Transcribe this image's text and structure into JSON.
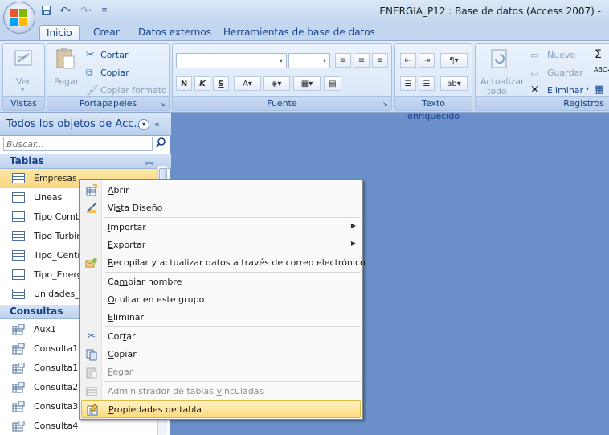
{
  "window": {
    "title": "ENERGIA_P12 : Base de datos (Access 2007) -"
  },
  "tabs": [
    "Inicio",
    "Crear",
    "Datos externos",
    "Herramientas de base de datos"
  ],
  "ribbon": {
    "vistas": {
      "label": "Vistas",
      "ver": "Ver"
    },
    "portapapeles": {
      "label": "Portapapeles",
      "pegar": "Pegar",
      "cortar": "Cortar",
      "copiar": "Copiar",
      "copiar_formato": "Copiar formato"
    },
    "fuente": {
      "label": "Fuente"
    },
    "texto": {
      "label": "Texto enriquecido"
    },
    "registros": {
      "label": "Registros",
      "actualizar1": "Actualizar",
      "actualizar2": "todo",
      "nuevo": "Nuevo",
      "guardar": "Guardar",
      "eliminar": "Eliminar"
    }
  },
  "nav": {
    "title": "Todos los objetos de Acc...",
    "search_placeholder": "Buscar...",
    "tables_header": "Tablas",
    "tables": [
      "Empresas",
      "Lineas",
      "Tipo Comb",
      "Tipo Turbin",
      "Tipo_Centr",
      "Tipo_Energ",
      "Unidades_("
    ],
    "queries_header": "Consultas",
    "queries": [
      "Aux1",
      "Consulta1",
      "Consulta10",
      "Consulta2",
      "Consulta3",
      "Consulta4"
    ]
  },
  "context_menu": [
    {
      "label": "Abrir",
      "u": "A",
      "icon": "open-icon",
      "enabled": true
    },
    {
      "label": "Vista Diseño",
      "u": "s",
      "icon": "design-view-icon",
      "enabled": true
    },
    {
      "label": "Importar",
      "u": "I",
      "submenu": true,
      "enabled": true
    },
    {
      "label": "Exportar",
      "u": "E",
      "submenu": true,
      "enabled": true
    },
    {
      "label": "Recopilar y actualizar datos a través de correo electrónico",
      "u": "R",
      "icon": "email-collect-icon",
      "enabled": true
    },
    {
      "label": "Cambiar nombre",
      "u": "m",
      "enabled": true
    },
    {
      "label": "Ocultar en este grupo",
      "u": "O",
      "enabled": true
    },
    {
      "label": "Eliminar",
      "u": "E",
      "enabled": true
    },
    {
      "label": "Cortar",
      "u": "t",
      "icon": "scissors-icon",
      "enabled": true
    },
    {
      "label": "Copiar",
      "u": "C",
      "icon": "copy-icon",
      "enabled": true
    },
    {
      "label": "Pegar",
      "u": "P",
      "icon": "paste-icon",
      "enabled": false
    },
    {
      "label": "Administrador de tablas vinculadas",
      "u": "v",
      "icon": "linked-tables-icon",
      "enabled": false
    },
    {
      "label": "Propiedades de tabla",
      "u": "P",
      "icon": "properties-icon",
      "enabled": true,
      "highlighted": true
    }
  ],
  "colors": {
    "accent": "#15428b",
    "workspace": "#6b8fc8",
    "highlight": "#ffd97a"
  }
}
